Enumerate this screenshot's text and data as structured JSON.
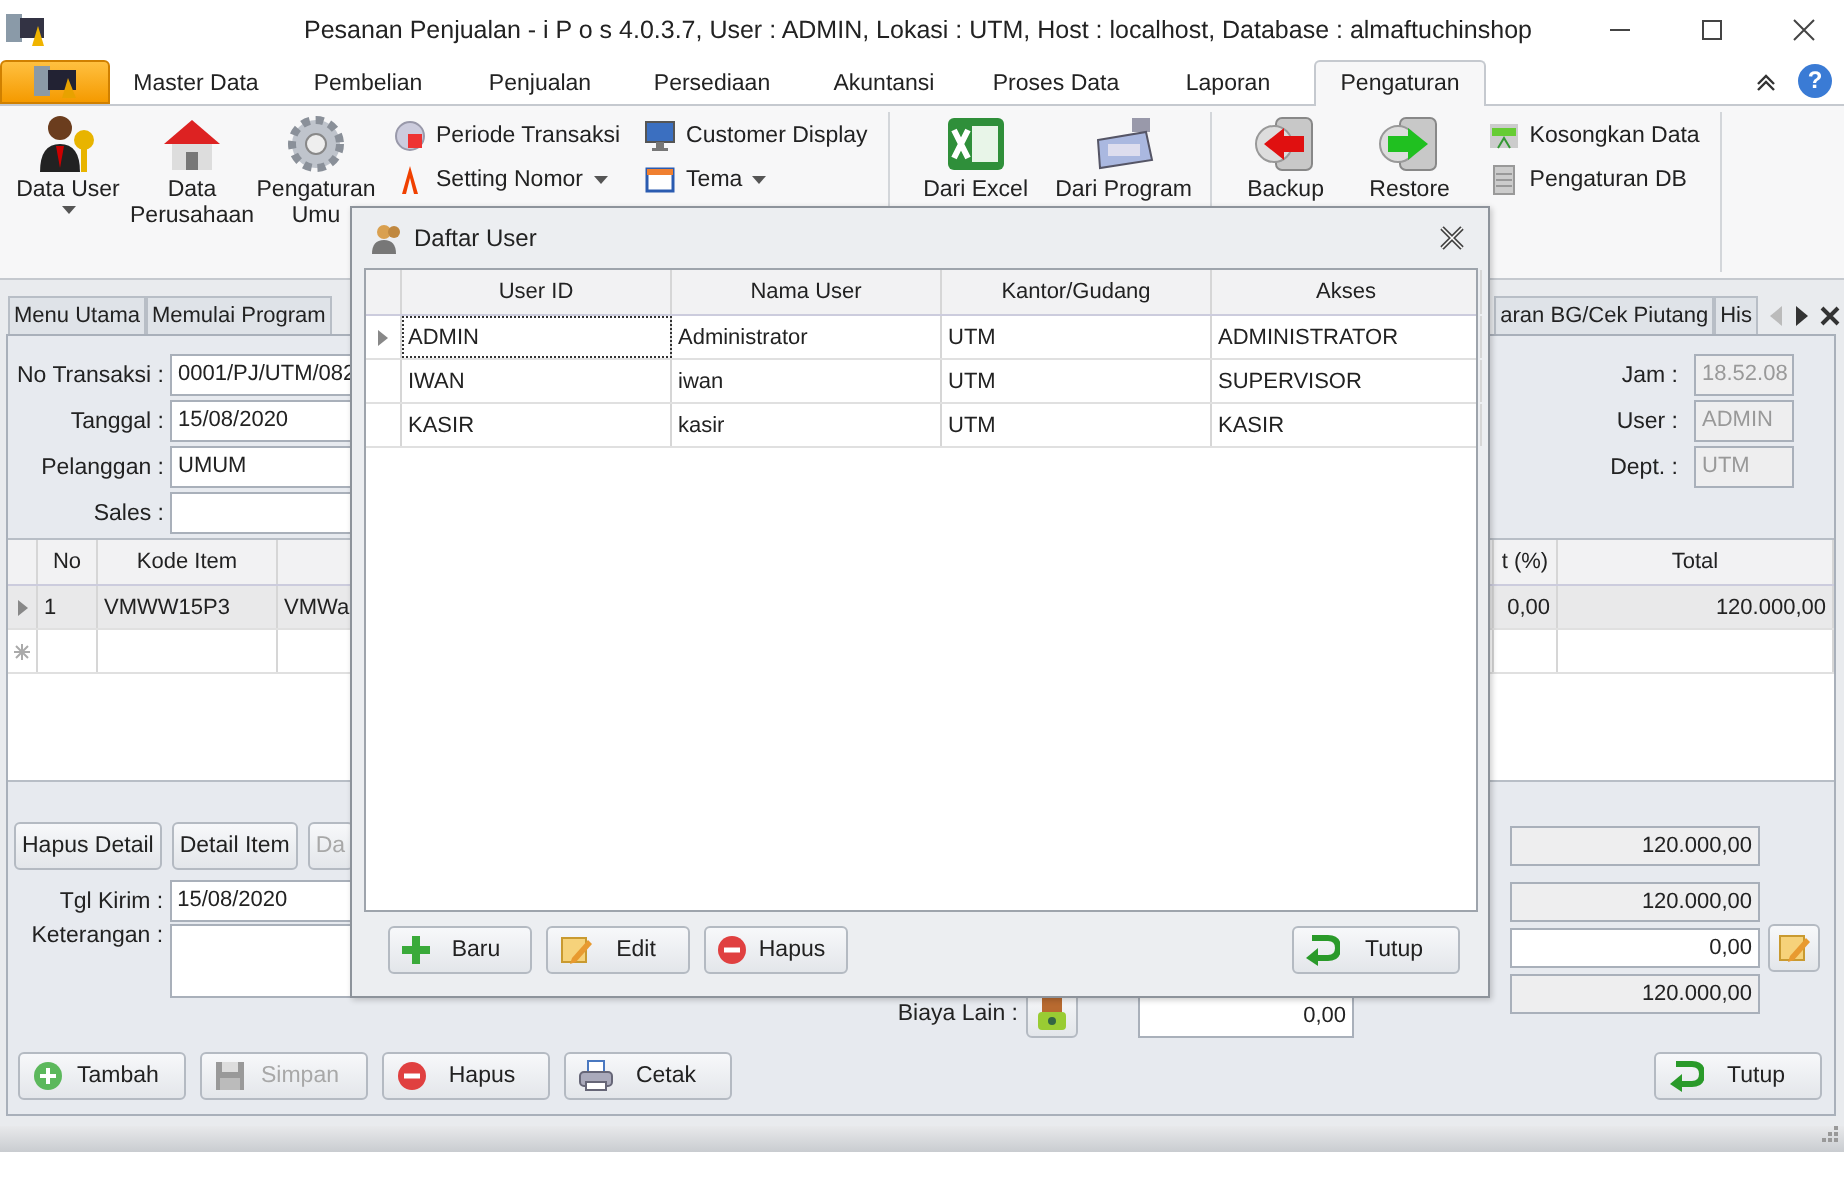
{
  "window": {
    "title": "Pesanan Penjualan - i P o s 4.0.3.7,  User : ADMIN, Lokasi : UTM, Host : localhost, Database : almaftuchinshop"
  },
  "ribbon": {
    "tabs": [
      {
        "label": "Master Data",
        "selected": false
      },
      {
        "label": "Pembelian",
        "selected": false
      },
      {
        "label": "Penjualan",
        "selected": false
      },
      {
        "label": "Persediaan",
        "selected": false
      },
      {
        "label": "Akuntansi",
        "selected": false
      },
      {
        "label": "Proses Data",
        "selected": false
      },
      {
        "label": "Laporan",
        "selected": false
      },
      {
        "label": "Pengaturan",
        "selected": true
      }
    ],
    "help_button": {
      "label": "?"
    },
    "large_buttons": [
      {
        "label": "Data User",
        "dropdown": true
      },
      {
        "label": "Data Perusahaan",
        "dropdown": false
      },
      {
        "label": "Pengaturan Umu",
        "dropdown": false
      }
    ],
    "small_buttons": [
      {
        "label": "Periode Transaksi",
        "dropdown": false
      },
      {
        "label": "Setting Nomor",
        "dropdown": true
      },
      {
        "label": "Customer Display",
        "dropdown": false
      },
      {
        "label": "Tema",
        "dropdown": true
      }
    ],
    "import_buttons": [
      {
        "label": "Dari Excel"
      },
      {
        "label": "Dari Program"
      }
    ],
    "database_buttons": [
      {
        "label": "Backup"
      },
      {
        "label": "Restore"
      }
    ],
    "database_small_buttons": [
      {
        "label": "Kosongkan Data"
      },
      {
        "label": "Pengaturan DB"
      }
    ]
  },
  "document_tabs": [
    {
      "label": "Menu Utama"
    },
    {
      "label": "Memulai Program"
    },
    {
      "label": "aran BG/Cek Piutang"
    },
    {
      "label": "His"
    }
  ],
  "form": {
    "fields": [
      {
        "label": "No Transaksi :",
        "value": "0001/PJ/UTM/082"
      },
      {
        "label": "Tanggal :",
        "value": "15/08/2020"
      },
      {
        "label": "Pelanggan :",
        "value": "UMUM"
      },
      {
        "label": "Sales :"
      }
    ],
    "info": [
      {
        "label": "Jam :",
        "value": "18.52.08"
      },
      {
        "label": "User :",
        "value": "ADMIN"
      },
      {
        "label": "Dept. :",
        "value": "UTM"
      }
    ]
  },
  "items_table": {
    "columns": [
      {
        "label": "No"
      },
      {
        "label": "Kode Item"
      },
      {},
      {
        "label": "t (%)"
      },
      {
        "label": "Total"
      }
    ],
    "rows": [
      {
        "cells": [
          "1",
          "VMWW15P3",
          "VMWa",
          "0,00",
          "120.000,00"
        ],
        "current": true
      }
    ]
  },
  "detail_buttons": [
    {
      "label": "Hapus Detail",
      "disabled": false
    },
    {
      "label": "Detail Item",
      "disabled": false
    },
    {
      "label": "Da",
      "disabled": true
    }
  ],
  "tgl_kirim": {
    "label": "Tgl Kirim :",
    "value": "15/08/2020"
  },
  "keterangan": {
    "label": "Keterangan :"
  },
  "biaya_lain": {
    "label": "Biaya Lain :",
    "value": "0,00"
  },
  "totals": [
    {
      "value": "120.000,00",
      "editable": false
    },
    {
      "value": "120.000,00",
      "editable": false
    },
    {
      "value": "0,00",
      "editable": true
    },
    {
      "value": "120.000,00",
      "editable": false
    }
  ],
  "actions": [
    {
      "label": "Tambah",
      "disabled": false
    },
    {
      "label": "Simpan",
      "disabled": true
    },
    {
      "label": "Hapus",
      "disabled": false
    },
    {
      "label": "Cetak",
      "disabled": false
    }
  ],
  "close_button": {
    "label": "Tutup"
  },
  "dialog": {
    "title": "Daftar User",
    "columns": [
      {
        "label": "User ID"
      },
      {
        "label": "Nama User"
      },
      {
        "label": "Kantor/Gudang"
      },
      {
        "label": "Akses"
      }
    ],
    "rows": [
      {
        "cells": [
          "ADMIN",
          "Administrator",
          "UTM",
          "ADMINISTRATOR"
        ],
        "current": true
      },
      {
        "cells": [
          "IWAN",
          "iwan",
          "UTM",
          "SUPERVISOR"
        ],
        "current": false
      },
      {
        "cells": [
          "KASIR",
          "kasir",
          "UTM",
          "KASIR"
        ],
        "current": false
      }
    ],
    "buttons": [
      {
        "label": "Baru"
      },
      {
        "label": "Edit"
      },
      {
        "label": "Hapus"
      }
    ],
    "close_button": {
      "label": "Tutup"
    }
  }
}
